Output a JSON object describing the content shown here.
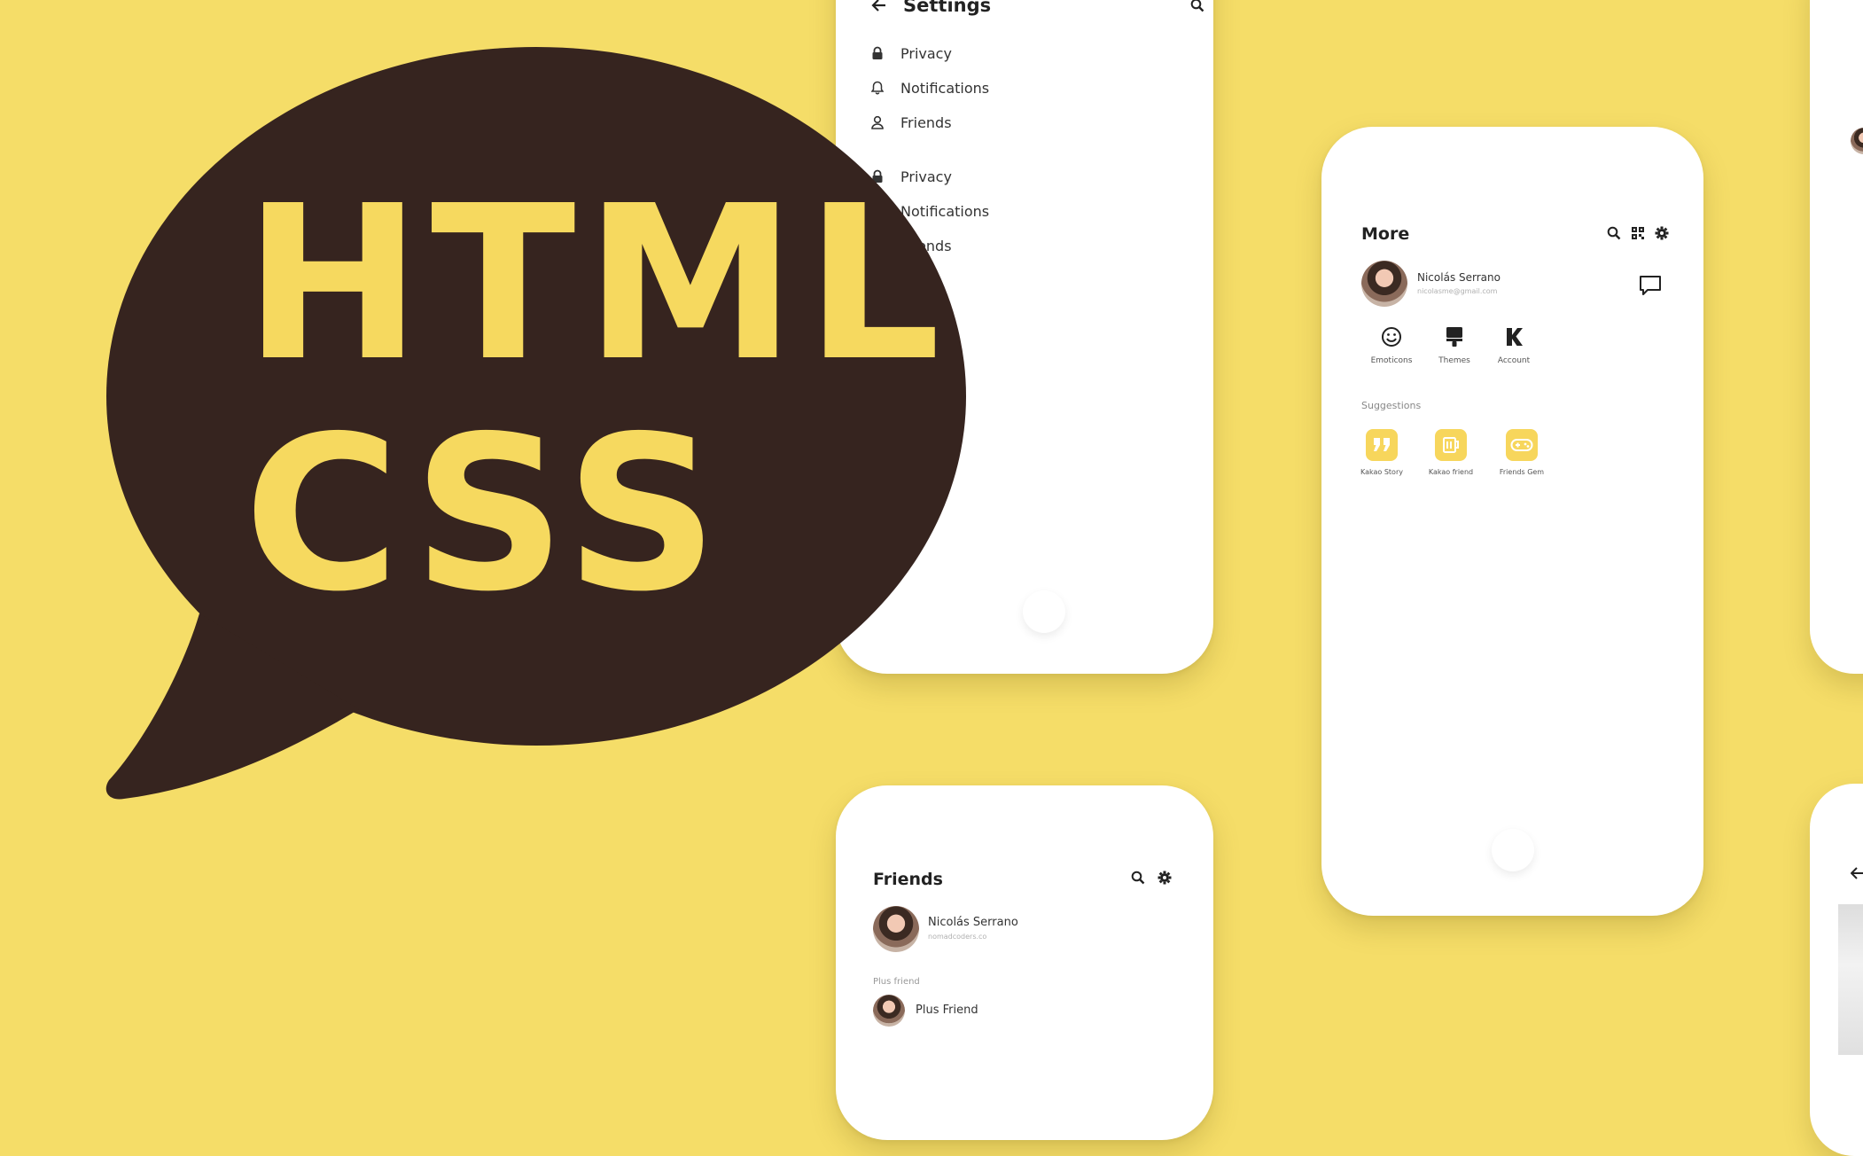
{
  "colors": {
    "background": "#f5dd68",
    "bubble": "#36241f",
    "bubble_text": "#f6d95f",
    "tile": "#f7d65c"
  },
  "logo": {
    "line1": "HTML",
    "line2": "CSS"
  },
  "settings": {
    "title": "Settings",
    "items": [
      {
        "label": "Privacy",
        "icon": "lock-icon"
      },
      {
        "label": "Notifications",
        "icon": "bell-icon"
      },
      {
        "label": "Friends",
        "icon": "person-icon"
      },
      {
        "label": "Privacy",
        "icon": "lock-icon"
      },
      {
        "label": "Notifications",
        "icon": "bell-icon"
      },
      {
        "label": "Friends",
        "icon": "person-icon"
      }
    ]
  },
  "more": {
    "title": "More",
    "profile": {
      "name": "Nicolás Serrano",
      "email": "nicolasme@gmail.com"
    },
    "quick_actions": [
      {
        "label": "Emoticons",
        "icon": "smiley-icon"
      },
      {
        "label": "Themes",
        "icon": "brush-icon"
      },
      {
        "label": "Account",
        "icon": "k-icon"
      }
    ],
    "suggestions_label": "Suggestions",
    "suggestions": [
      {
        "label": "Kakao Story",
        "icon": "quote-icon"
      },
      {
        "label": "Kakao friend",
        "icon": "store-icon"
      },
      {
        "label": "Friends Gem",
        "icon": "gamepad-icon"
      }
    ]
  },
  "friends": {
    "title": "Friends",
    "profile": {
      "name": "Nicolás Serrano",
      "email": "nomadcoders.co"
    },
    "section_label": "Plus friend",
    "plus_friend": "Plus Friend"
  }
}
